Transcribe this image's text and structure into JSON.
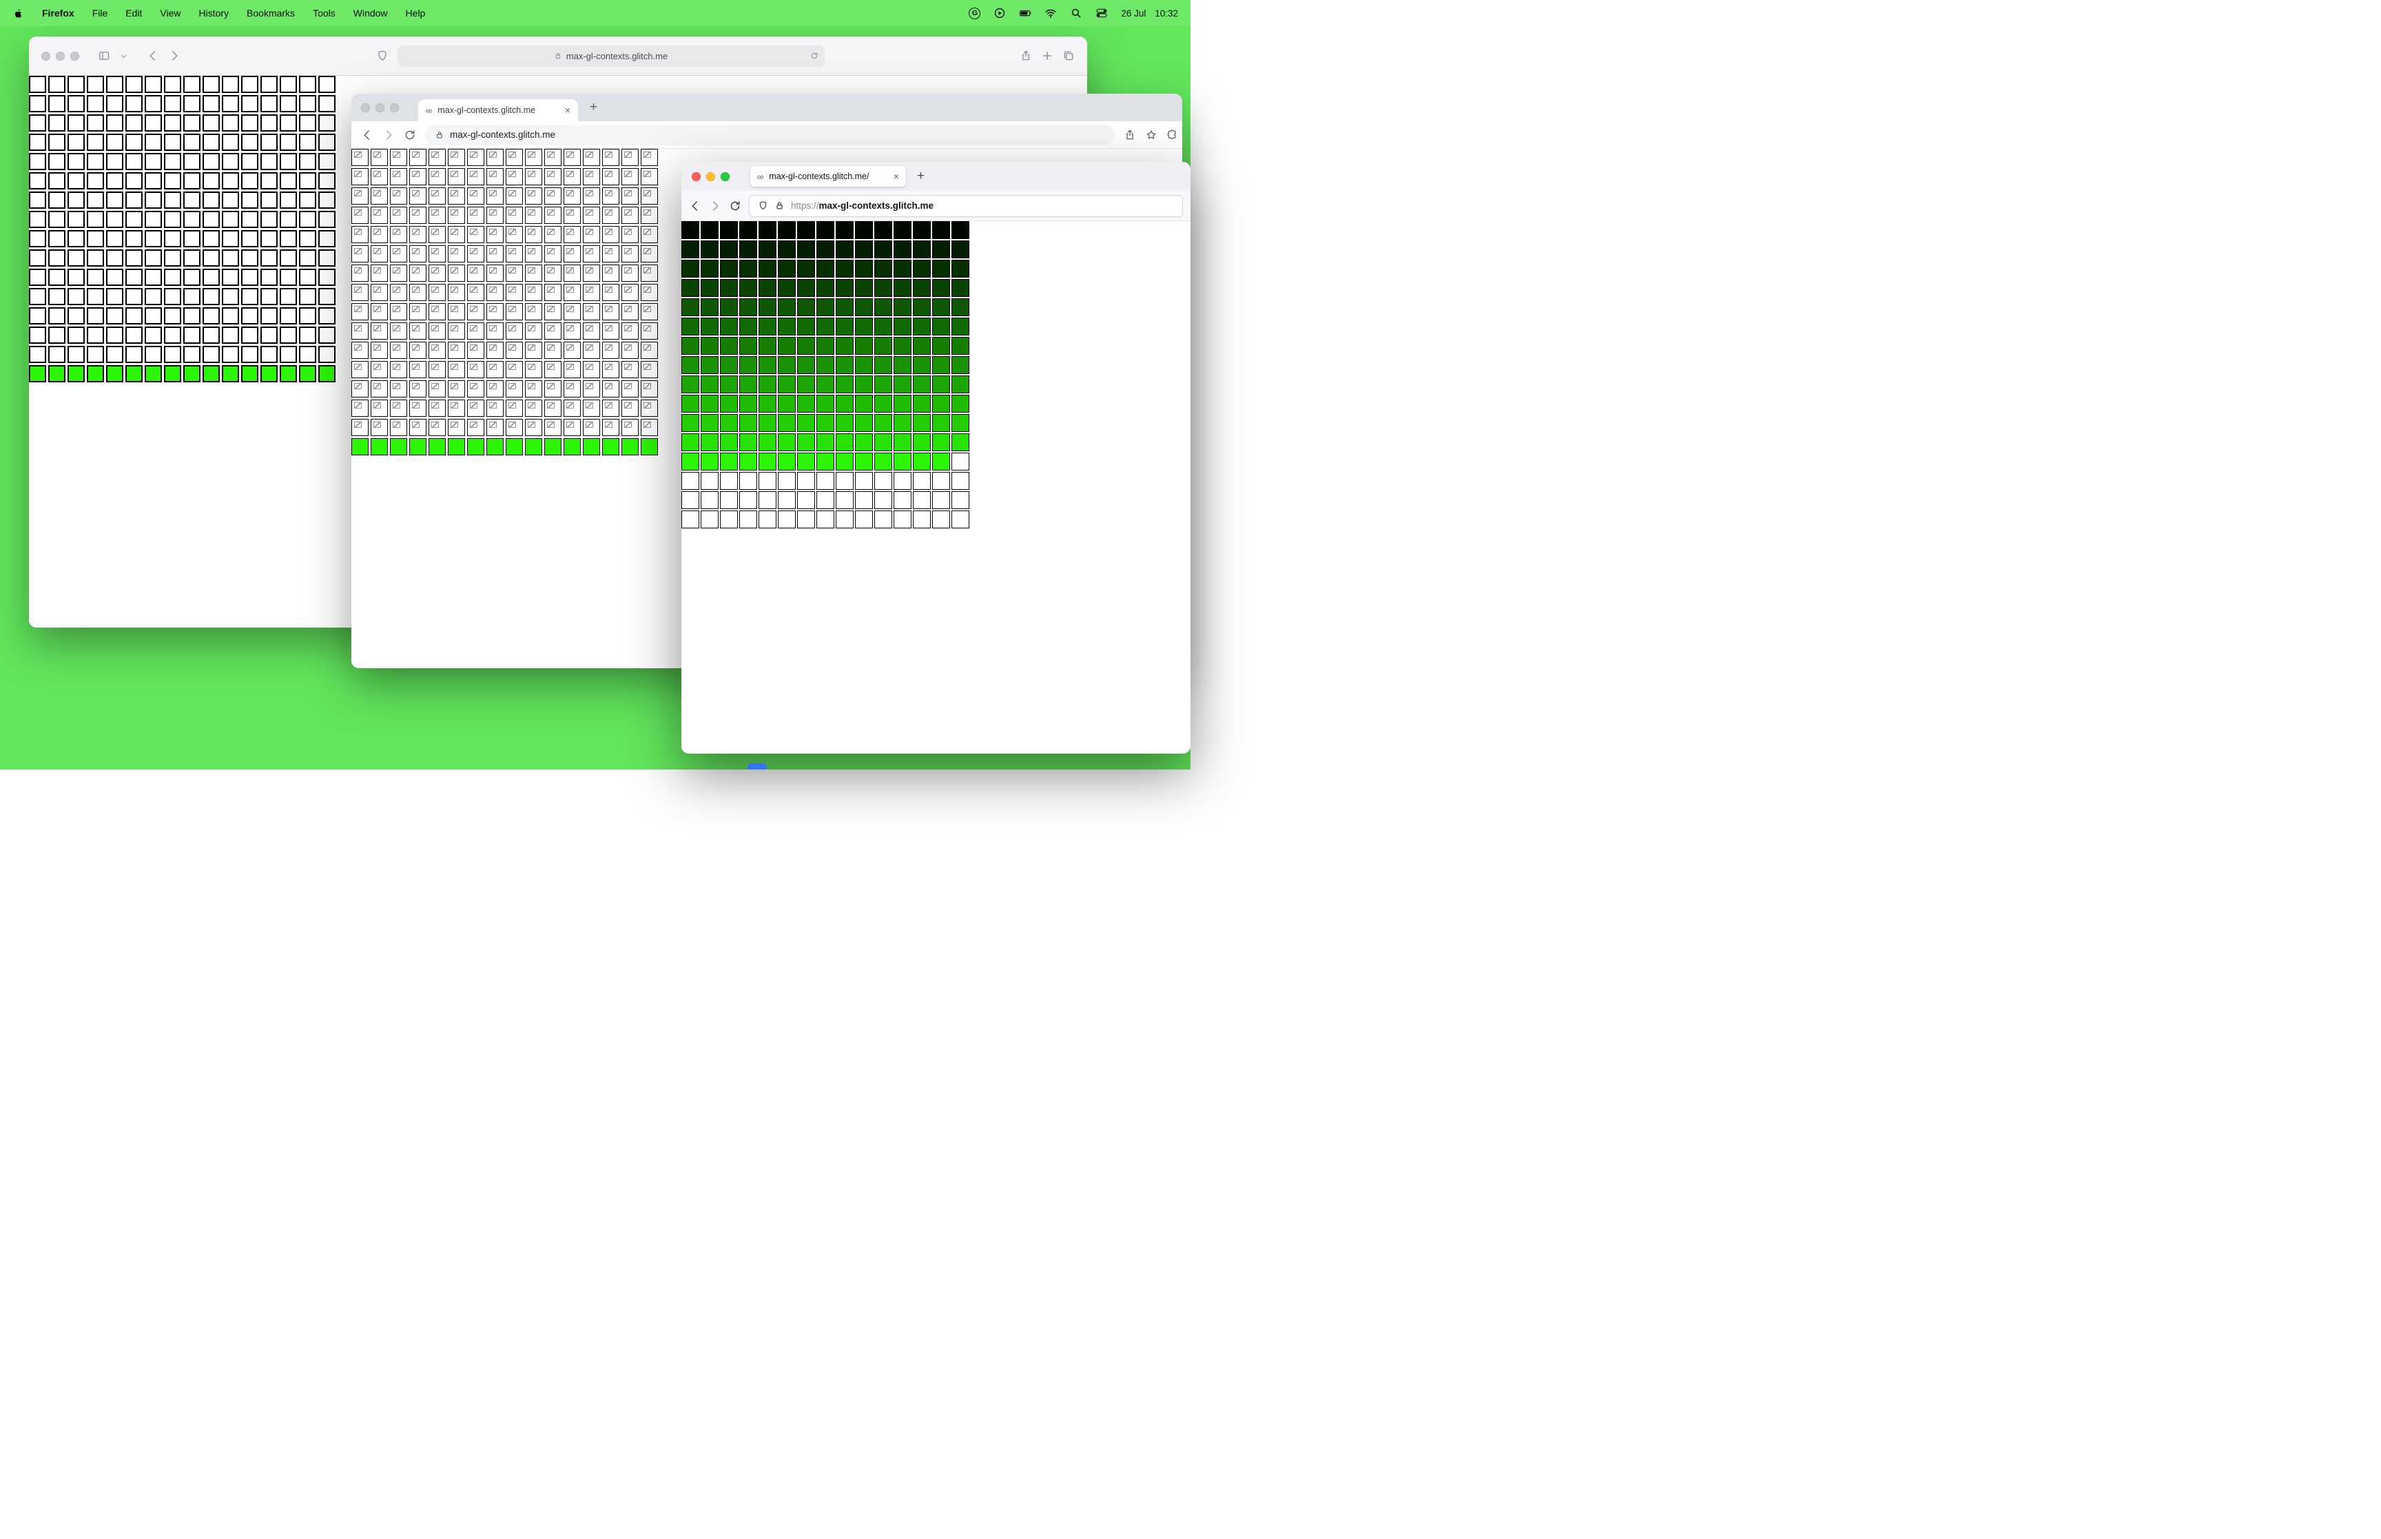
{
  "ui": {
    "infinity": "∞",
    "close": "×",
    "plus": "+"
  },
  "colors": {
    "desktop": "#62e65c",
    "lime": "#2cf505"
  },
  "menubar": {
    "app_name": "Firefox",
    "menus": [
      "File",
      "Edit",
      "View",
      "History",
      "Bookmarks",
      "Tools",
      "Window",
      "Help"
    ],
    "status_icons": [
      "grammarly-icon",
      "play-circle-icon",
      "battery-icon",
      "wifi-icon",
      "spotlight-icon",
      "control-center-icon"
    ],
    "date": "26 Jul",
    "time": "10:32"
  },
  "safari_window": {
    "url": "max-gl-contexts.glitch.me",
    "grid": {
      "cols": 16,
      "cell": 25,
      "gap": 3,
      "border": 2,
      "rows": [
        {
          "n": 15,
          "fill": "#ffffff"
        },
        {
          "n": 1,
          "fill": "#2cf505"
        }
      ]
    }
  },
  "chrome_window": {
    "tab_title": "max-gl-contexts.glitch.me",
    "url": "max-gl-contexts.glitch.me",
    "grid": {
      "cols": 16,
      "cell": 25,
      "gap": 3,
      "border": 1,
      "rows": [
        {
          "n": 15,
          "fill": "#ffffff",
          "broken": true
        },
        {
          "n": 1,
          "fill": "#2cf505"
        }
      ]
    }
  },
  "firefox_window": {
    "tab_title": "max-gl-contexts.glitch.me/",
    "url_scheme": "https://",
    "url_host": "max-gl-contexts.glitch.me",
    "grid": {
      "cols": 15,
      "cell": 26,
      "gap": 2,
      "border": 1,
      "rows": [
        {
          "n": 1,
          "fill": "#000800"
        },
        {
          "n": 1,
          "fill": "#041c00"
        },
        {
          "n": 1,
          "fill": "#073001"
        },
        {
          "n": 1,
          "fill": "#0b4301"
        },
        {
          "n": 1,
          "fill": "#0f5702"
        },
        {
          "n": 1,
          "fill": "#126b02"
        },
        {
          "n": 1,
          "fill": "#167f02"
        },
        {
          "n": 1,
          "fill": "#1a9203"
        },
        {
          "n": 1,
          "fill": "#1da603"
        },
        {
          "n": 1,
          "fill": "#21ba04"
        },
        {
          "n": 1,
          "fill": "#25ce04"
        },
        {
          "n": 1,
          "fill": "#28e105"
        },
        {
          "n": 1,
          "cells": [
            "#2cf505",
            "#2cf505",
            "#2cf505",
            "#2cf505",
            "#2cf505",
            "#2cf505",
            "#2cf505",
            "#2cf505",
            "#2cf505",
            "#2cf505",
            "#2cf505",
            "#2cf505",
            "#2cf505",
            "#2cf505",
            "#ffffff"
          ]
        },
        {
          "n": 3,
          "fill": "#ffffff"
        }
      ]
    }
  }
}
